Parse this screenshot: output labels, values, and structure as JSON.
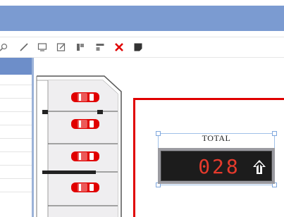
{
  "app": {
    "colors": {
      "titlebar": "#7b9bd1",
      "accent_red": "#e00000",
      "display_bg": "#1c1c1c",
      "digit_color": "#e53a2c",
      "car_color": "#e00000"
    }
  },
  "toolbar": {
    "items": [
      {
        "name": "zoom-icon"
      },
      {
        "name": "line-icon"
      },
      {
        "name": "monitor-icon"
      },
      {
        "name": "edit-icon"
      },
      {
        "name": "align-icon"
      },
      {
        "name": "layout-icon"
      },
      {
        "name": "delete-icon"
      },
      {
        "name": "note-icon"
      }
    ]
  },
  "widget": {
    "label": "TOTAL",
    "count": "028",
    "direction_icon": "arrow-up-icon"
  },
  "parking": {
    "cars": [
      {
        "name": "car-1",
        "color": "#e00000"
      },
      {
        "name": "car-2",
        "color": "#e00000"
      },
      {
        "name": "car-3",
        "color": "#e00000"
      },
      {
        "name": "car-4",
        "color": "#e00000"
      }
    ]
  }
}
